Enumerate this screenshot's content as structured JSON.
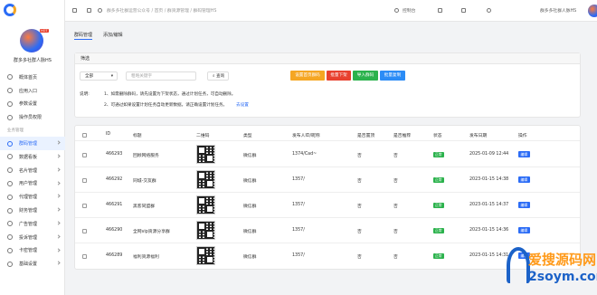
{
  "topbar": {
    "breadcrumb": "群多多社群运营公众号 / 首页 / 群资源管理 / 群码管理HS",
    "console": "控制台",
    "user_name": "群多多社群人脉HS"
  },
  "sidebar": {
    "brand_name": "群多多社群人脉HS",
    "badge": "HOT",
    "items_top": [
      {
        "label": "概体首页"
      },
      {
        "label": "应用入口"
      },
      {
        "label": "参数设置"
      },
      {
        "label": "操作员权限"
      }
    ],
    "section": "业务管理",
    "items": [
      {
        "label": "群码管理",
        "active": true
      },
      {
        "label": "数据看板"
      },
      {
        "label": "名片管理"
      },
      {
        "label": "用户管理"
      },
      {
        "label": "代理管理"
      },
      {
        "label": "财务管理"
      },
      {
        "label": "广告管理"
      },
      {
        "label": "投诉管理"
      },
      {
        "label": "卡密管理"
      },
      {
        "label": "基础设置"
      }
    ]
  },
  "tabs": [
    {
      "label": "群码管理",
      "active": true
    },
    {
      "label": "添加/编辑",
      "active": false
    }
  ],
  "filter": {
    "title": "筛选",
    "select_value": "全部",
    "keyword_placeholder": "粗略关键字",
    "query_button": "查询",
    "buttons": [
      {
        "label": "设置首页群码",
        "color": "#f5a623"
      },
      {
        "label": "批量下架",
        "color": "#e8412f"
      },
      {
        "label": "导入群码",
        "color": "#2bb24c"
      },
      {
        "label": "批量复制",
        "color": "#2b8cf6"
      }
    ],
    "note_label": "说明:",
    "note_1": "1、如需删除群码，请先设置为下架状态，通过计划任务，可自动删除。",
    "note_2": "2、可通过如果设置计划任务自动更新数据，请正确设置计划任务。",
    "note_link": "去设置"
  },
  "table": {
    "headers": [
      "ID",
      "标题",
      "二维码",
      "类型",
      "发布人ID/昵称",
      "是否置顶",
      "是否推荐",
      "状态",
      "发布日期",
      "操作"
    ],
    "rows": [
      {
        "id": "466293",
        "title": "回顾网络服务",
        "type": "微信群",
        "publisher": "1374/Cad~",
        "top": "否",
        "recommend": "否",
        "status": "正常",
        "date": "2025-01-09 12:44",
        "action": "编辑"
      },
      {
        "id": "466292",
        "title": "同城-交友群",
        "type": "微信群",
        "publisher": "1357/",
        "top": "否",
        "recommend": "否",
        "status": "正常",
        "date": "2023-01-15 14:38",
        "action": "编辑"
      },
      {
        "id": "466291",
        "title": "黑客同盟群",
        "type": "微信群",
        "publisher": "1357/",
        "top": "否",
        "recommend": "否",
        "status": "正常",
        "date": "2023-01-15 14:37",
        "action": "编辑"
      },
      {
        "id": "466290",
        "title": "全网vip资源分享群",
        "type": "微信群",
        "publisher": "1357/",
        "top": "否",
        "recommend": "否",
        "status": "正常",
        "date": "2023-01-15 14:36",
        "action": "编辑"
      },
      {
        "id": "466289",
        "title": "福利资源福利",
        "type": "微信群",
        "publisher": "1357/",
        "top": "否",
        "recommend": "否",
        "status": "正常",
        "date": "2023-01-15 14:31",
        "action": "编辑"
      }
    ]
  },
  "watermark": {
    "cn": "爱搜源码网",
    "en": "2soym.com"
  }
}
